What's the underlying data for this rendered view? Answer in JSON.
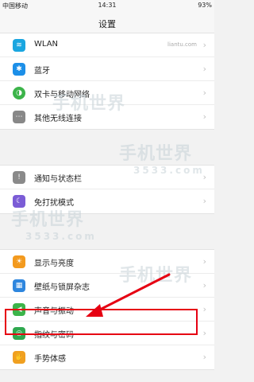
{
  "status_bar": {
    "carrier": "中国移动",
    "time": "14:31",
    "battery": "93%"
  },
  "title": "设置",
  "groups": [
    {
      "items": [
        {
          "label": "WLAN",
          "value": "liantu.com",
          "icon": "wifi-icon",
          "color": "#1aa6e0"
        },
        {
          "label": "蓝牙",
          "value": "",
          "icon": "bluetooth-icon",
          "color": "#1c8fe8"
        },
        {
          "label": "双卡与移动网络",
          "value": "",
          "icon": "dual-sim-icon",
          "color": "#3cb44a"
        },
        {
          "label": "其他无线连接",
          "value": "",
          "icon": "more-connections-icon",
          "color": "#888888"
        }
      ]
    },
    {
      "items": [
        {
          "label": "通知与状态栏",
          "value": "",
          "icon": "notification-icon",
          "color": "#8a8a8a"
        },
        {
          "label": "免打扰模式",
          "value": "",
          "icon": "moon-icon",
          "color": "#7b5cd6"
        }
      ]
    },
    {
      "items": [
        {
          "label": "显示与亮度",
          "value": "",
          "icon": "display-icon",
          "color": "#f39a1e"
        },
        {
          "label": "壁纸与锁屏杂志",
          "value": "",
          "icon": "wallpaper-icon",
          "color": "#2e86de"
        },
        {
          "label": "声音与振动",
          "value": "",
          "icon": "sound-icon",
          "color": "#3cb44a"
        },
        {
          "label": "指纹与密码",
          "value": "",
          "icon": "fingerprint-icon",
          "color": "#2fa84f"
        },
        {
          "label": "手势体感",
          "value": "",
          "icon": "gesture-icon",
          "color": "#f0a020"
        }
      ]
    }
  ],
  "watermark": {
    "text": "手机世界",
    "number": "3533.com"
  },
  "accent_color": "#e60012"
}
